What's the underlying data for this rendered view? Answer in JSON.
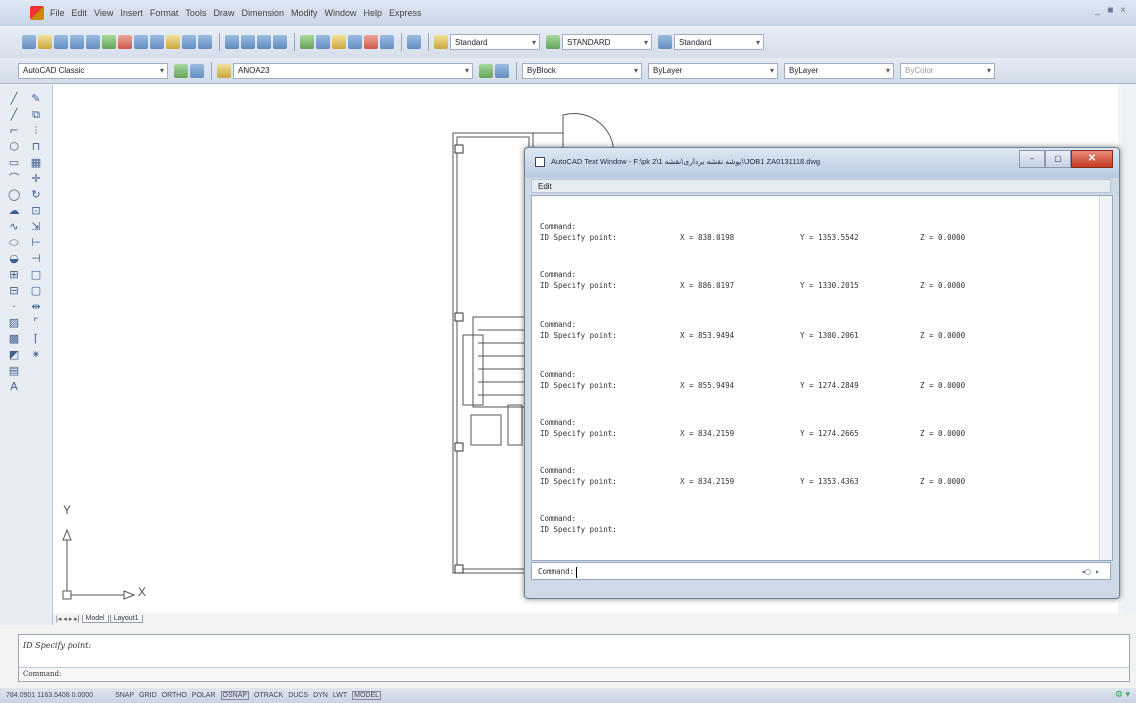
{
  "menu": {
    "items": [
      "File",
      "Edit",
      "View",
      "Insert",
      "Format",
      "Tools",
      "Draw",
      "Dimension",
      "Modify",
      "Window",
      "Help",
      "Express"
    ],
    "window_controls": "_ ■ ×"
  },
  "toolbar1": {
    "text_style": "Standard",
    "dim_style": "STANDARD",
    "table_style": "Standard"
  },
  "toolbar2": {
    "workspace": "AutoCAD Classic",
    "layer": "ANOA23",
    "color": "ByBlock",
    "linetype": "ByLayer",
    "lineweight": "ByLayer",
    "plotstyle": "ByColor"
  },
  "drawing": {
    "ucs_y": "Y",
    "ucs_x": "X"
  },
  "tabs": {
    "nav": "|◂ ◂ ▸ ▸|",
    "model": "Model",
    "layout": "Layout1"
  },
  "command_line": {
    "history": "ID Specify point:",
    "prompt": "Command:"
  },
  "status": {
    "coords": "784.0901  1163.5408  0.0000",
    "buttons": [
      "SNAP",
      "GRID",
      "ORTHO",
      "POLAR",
      "OSNAP",
      "OTRACK",
      "DUCS",
      "DYN",
      "LWT",
      "MODEL"
    ]
  },
  "text_window": {
    "title": "AutoCAD Text Window - F:\\pk 2\\پوشه نقشه برداری\\نقشه 1\\\\JOB1 ZA0131118.dwg",
    "menu_edit": "Edit",
    "entries": [
      {
        "label": "Command:",
        "prompt": "ID Specify point:",
        "x": "X = 838.0198",
        "y": "Y = 1353.5542",
        "z": "Z = 0.0000"
      },
      {
        "label": "Command:",
        "prompt": "ID Specify point:",
        "x": "X = 886.0197",
        "y": "Y = 1330.2015",
        "z": "Z = 0.0000"
      },
      {
        "label": "Command:",
        "prompt": "ID Specify point:",
        "x": "X = 853.9494",
        "y": "Y = 1300.2061",
        "z": "Z = 0.0000"
      },
      {
        "label": "Command:",
        "prompt": "ID Specify point:",
        "x": "X = 855.9494",
        "y": "Y = 1274.2849",
        "z": "Z = 0.0000"
      },
      {
        "label": "Command:",
        "prompt": "ID Specify point:",
        "x": "X = 834.2159",
        "y": "Y = 1274.2665",
        "z": "Z = 0.0000"
      },
      {
        "label": "Command:",
        "prompt": "ID Specify point:",
        "x": "X = 834.2159",
        "y": "Y = 1353.4363",
        "z": "Z = 0.0000"
      }
    ],
    "last_label": "Command:",
    "last_prompt": "ID Specify point:",
    "input_prompt": "Command:"
  }
}
